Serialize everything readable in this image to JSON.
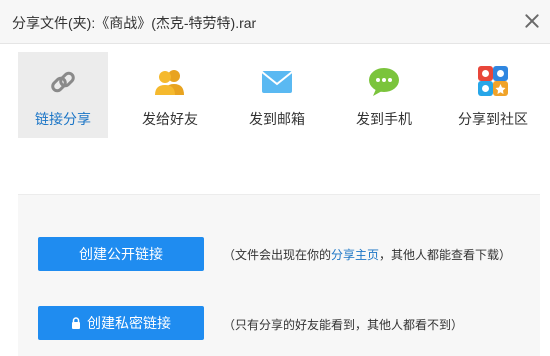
{
  "dialog": {
    "title": "分享文件(夹):《商战》(杰克-特劳特).rar"
  },
  "tabs": [
    {
      "label": "链接分享",
      "icon": "link-icon",
      "active": true
    },
    {
      "label": "发给好友",
      "icon": "friends-icon",
      "active": false
    },
    {
      "label": "发到邮箱",
      "icon": "mail-icon",
      "active": false
    },
    {
      "label": "发到手机",
      "icon": "sms-icon",
      "active": false
    },
    {
      "label": "分享到社区",
      "icon": "community-icon",
      "active": false
    }
  ],
  "actions": {
    "public_label": "创建公开链接",
    "public_desc_prefix": "（文件会出现在你的",
    "public_desc_link": "分享主页",
    "public_desc_suffix": "，其他人都能查看下载）",
    "private_label": "创建私密链接",
    "private_desc": "（只有分享的好友能看到，其他人都看不到）"
  },
  "colors": {
    "primary_button": "#1f8cf0",
    "active_tab_text": "#1b75c6",
    "active_tab_bg": "#ececec"
  }
}
